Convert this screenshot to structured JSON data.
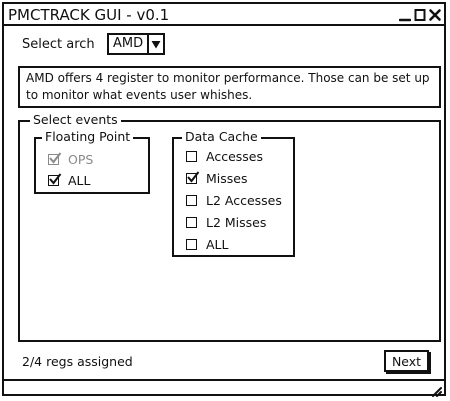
{
  "window": {
    "title": "PMCTRACK GUI - v0.1",
    "controls": [
      "minimize-icon",
      "maximize-icon",
      "close-icon"
    ]
  },
  "arch": {
    "label": "Select arch",
    "selected": "AMD"
  },
  "info": {
    "text": "AMD offers 4 register to monitor performance. Those can be set up to monitor what events user whishes."
  },
  "events": {
    "legend": "Select events",
    "floating_point": {
      "legend": "Floating Point",
      "items": [
        {
          "label": "OPS",
          "checked": true,
          "disabled": true
        },
        {
          "label": "ALL",
          "checked": true,
          "disabled": false
        }
      ]
    },
    "data_cache": {
      "legend": "Data Cache",
      "items": [
        {
          "label": "Accesses",
          "checked": false
        },
        {
          "label": "Misses",
          "checked": true
        },
        {
          "label": "L2 Accesses",
          "checked": false
        },
        {
          "label": "L2 Misses",
          "checked": false
        },
        {
          "label": "ALL",
          "checked": false
        }
      ]
    }
  },
  "footer": {
    "status": "2/4 regs assigned",
    "next_label": "Next"
  }
}
